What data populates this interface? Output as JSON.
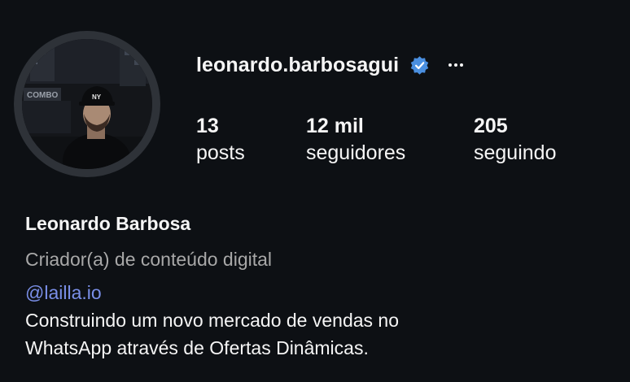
{
  "profile": {
    "username": "leonardo.barbosagui",
    "verified_icon": "verified-badge-icon",
    "more_icon": "more-options-icon",
    "full_name": "Leonardo Barbosa",
    "category": "Criador(a) de conteúdo digital",
    "mention": "@lailla.io",
    "bio_lines": [
      "Construindo um novo mercado de vendas no",
      "WhatsApp através de Ofertas Dinâmicas."
    ]
  },
  "stats": {
    "posts": {
      "value": "13",
      "label": "posts"
    },
    "followers": {
      "value": "12 mil",
      "label": "seguidores"
    },
    "following": {
      "value": "205",
      "label": "seguindo"
    }
  },
  "colors": {
    "background": "#0d1014",
    "text": "#f5f5f5",
    "muted": "#a8a8a8",
    "link": "#7a8fe8",
    "verified": "#4a8fe0",
    "avatar_ring": "#2e3238"
  }
}
